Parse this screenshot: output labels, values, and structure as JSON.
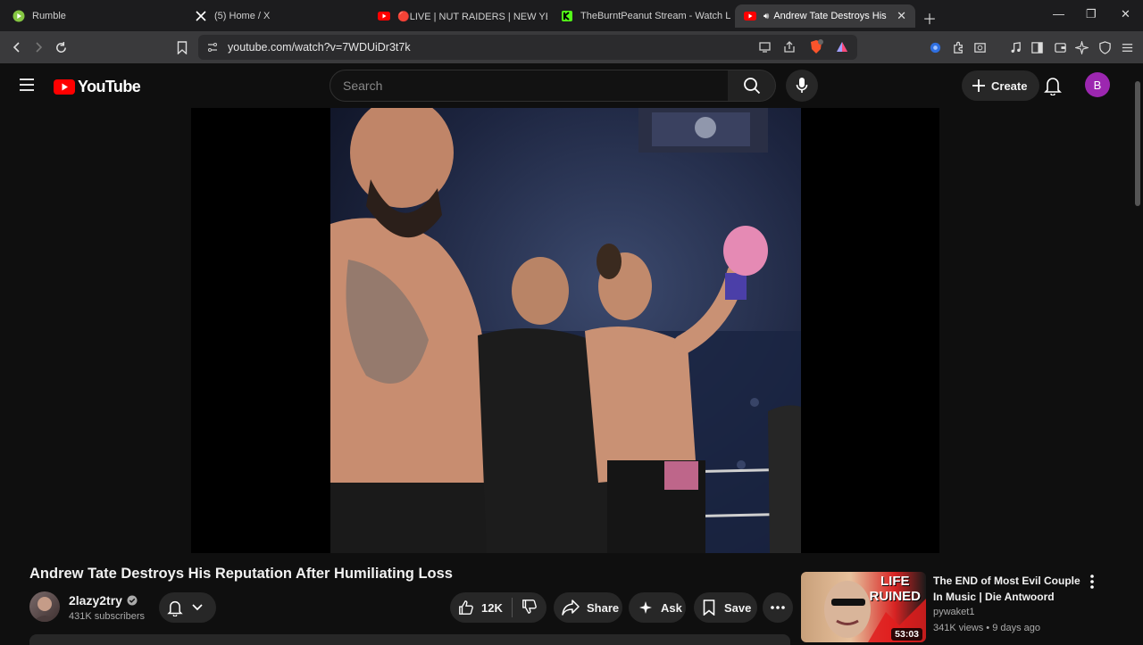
{
  "browser": {
    "tabs": [
      {
        "title": "Rumble",
        "icon": "rumble-icon"
      },
      {
        "title": "(5) Home / X",
        "icon": "x-icon"
      },
      {
        "title": "🔴LIVE | NUT RAIDERS | NEW YEAR N",
        "icon": "youtube-icon"
      },
      {
        "title": "TheBurntPeanut Stream - Watch Live",
        "icon": "kick-icon"
      },
      {
        "title": "Andrew Tate Destroys His Rep",
        "icon": "youtube-icon",
        "active": true
      }
    ],
    "url": "youtube.com/watch?v=7WDUiDr3t7k"
  },
  "youtube": {
    "logo_text": "YouTube",
    "search_placeholder": "Search",
    "create_label": "Create",
    "avatar_letter": "B",
    "video": {
      "title": "Andrew Tate Destroys His Reputation After Humiliating Loss",
      "channel": "2lazy2try",
      "subscribers": "431K subscribers",
      "likes": "12K",
      "share_label": "Share",
      "ask_label": "Ask",
      "save_label": "Save"
    },
    "suggestion": {
      "title": "The END of Most Evil Couple In Music | Die Antwoord",
      "channel": "pywaket1",
      "meta": "341K views • 9 days ago",
      "duration": "53:03",
      "thumb_text_1": "LIFE",
      "thumb_text_2": "RUINED"
    }
  }
}
